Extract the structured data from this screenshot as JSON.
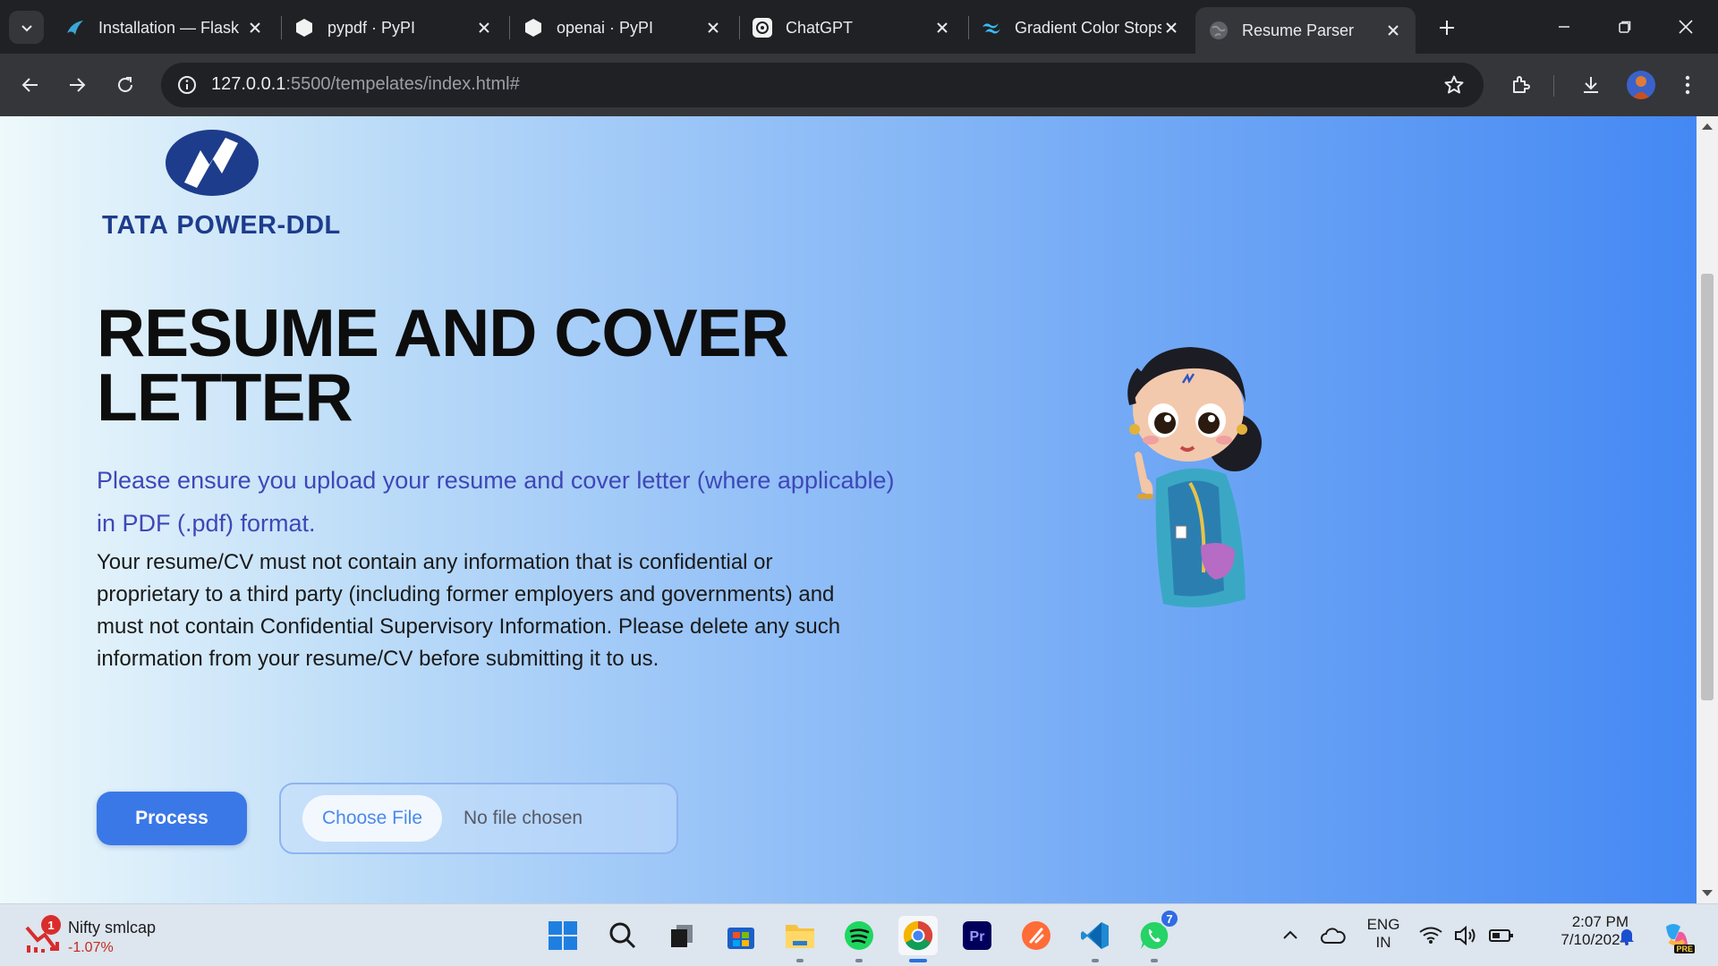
{
  "browser": {
    "tabs": [
      {
        "title": "Installation — Flask",
        "favicon": "flask-icon",
        "active": false
      },
      {
        "title": "pypdf · PyPI",
        "favicon": "pypi-icon",
        "active": false
      },
      {
        "title": "openai · PyPI",
        "favicon": "pypi-icon",
        "active": false
      },
      {
        "title": "ChatGPT",
        "favicon": "chatgpt-icon",
        "active": false
      },
      {
        "title": "Gradient Color Stops",
        "favicon": "tailwind-icon",
        "active": false
      },
      {
        "title": "Resume Parser",
        "favicon": "globe-icon",
        "active": true
      }
    ],
    "url": {
      "host": "127.0.0.1",
      "path": ":5500/tempelates/index.html#"
    }
  },
  "page": {
    "logo": {
      "brand_bold": "TATA",
      "brand_rest": "POWER-DDL"
    },
    "heading": "RESUME AND COVER LETTER",
    "notice_blue": "Please ensure you upload your resume and cover letter (where applicable) in PDF (.pdf) format.",
    "notice_black": "Your resume/CV must not contain any information that is confidential or proprietary to a third party (including former employers and governments) and must not contain Confidential Supervisory Information. Please delete any such information from your resume/CV before submitting it to us.",
    "process_label": "Process",
    "choose_file_label": "Choose File",
    "no_file_label": "No file chosen"
  },
  "taskbar": {
    "widget": {
      "title": "Nifty smlcap",
      "value": "-1.07%",
      "badge": "1"
    },
    "whatsapp_badge": "7",
    "language": {
      "line1": "ENG",
      "line2": "IN"
    },
    "clock": {
      "time": "2:07 PM",
      "date": "7/10/2024"
    },
    "copilot_label": "PRE"
  },
  "colors": {
    "accent": "#3b78e7",
    "heading": "#0d0d0d",
    "notice_blue": "#3f47b8",
    "brand": "#1e3c8c"
  }
}
